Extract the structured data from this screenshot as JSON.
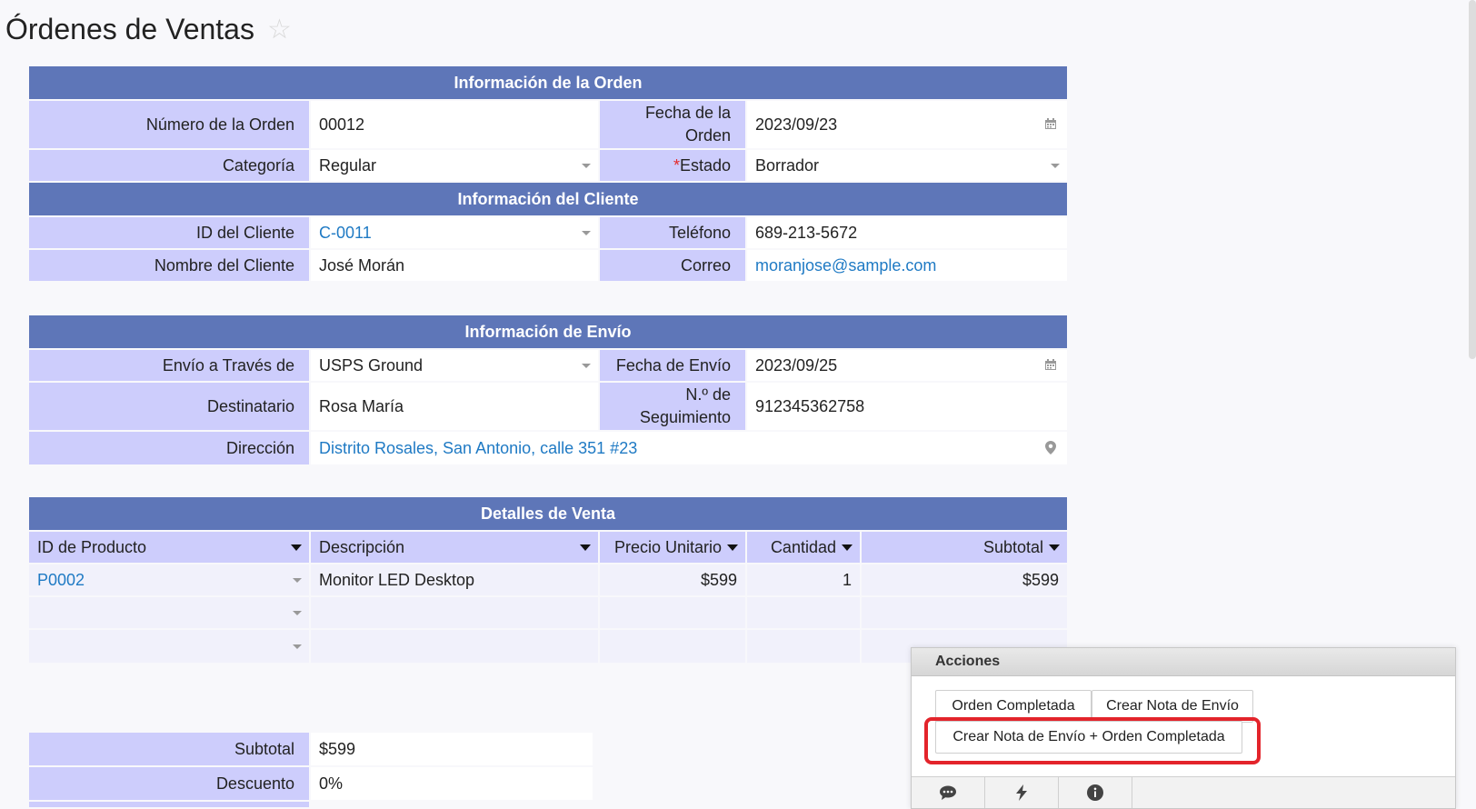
{
  "page": {
    "title": "Órdenes de Ventas"
  },
  "order_info": {
    "header": "Información de la Orden",
    "order_number_label": "Número de la Orden",
    "order_number": "00012",
    "order_date_label": "Fecha de la Orden",
    "order_date": "2023/09/23",
    "category_label": "Categoría",
    "category": "Regular",
    "status_label": "Estado",
    "status": "Borrador"
  },
  "customer_info": {
    "header": "Información del Cliente",
    "customer_id_label": "ID del Cliente",
    "customer_id": "C-0011",
    "phone_label": "Teléfono",
    "phone": "689-213-5672",
    "customer_name_label": "Nombre del Cliente",
    "customer_name": "José Morán",
    "email_label": "Correo",
    "email": "moranjose@sample.com"
  },
  "shipping_info": {
    "header": "Información de Envío",
    "ship_via_label": "Envío a Través de",
    "ship_via": "USPS Ground",
    "ship_date_label": "Fecha de Envío",
    "ship_date": "2023/09/25",
    "recipient_label": "Destinatario",
    "recipient": "Rosa María",
    "tracking_label": "N.º de Seguimiento",
    "tracking": "912345362758",
    "address_label": "Dirección",
    "address": "Distrito Rosales, San Antonio, calle 351 #23"
  },
  "sales_details": {
    "header": "Detalles de Venta",
    "columns": [
      "ID de Producto",
      "Descripción",
      "Precio Unitario",
      "Cantidad",
      "Subtotal"
    ],
    "rows": [
      {
        "product_id": "P0002",
        "description": "Monitor LED Desktop",
        "unit_price": "$599",
        "quantity": "1",
        "subtotal": "$599"
      }
    ]
  },
  "totals": {
    "subtotal_label": "Subtotal",
    "subtotal": "$599",
    "discount_label": "Descuento",
    "discount": "0%"
  },
  "actions": {
    "header": "Acciones",
    "buttons": [
      "Orden Completada",
      "Crear Nota de Envío",
      "Crear Nota de Envío + Orden Completada"
    ],
    "footer_icons": [
      "comment-icon",
      "lightning-icon",
      "info-icon"
    ]
  },
  "colors": {
    "section_header": "#5e76b8",
    "label_bg": "#cdcdfc",
    "link": "#1f7ac4",
    "highlight": "#e3242b"
  }
}
